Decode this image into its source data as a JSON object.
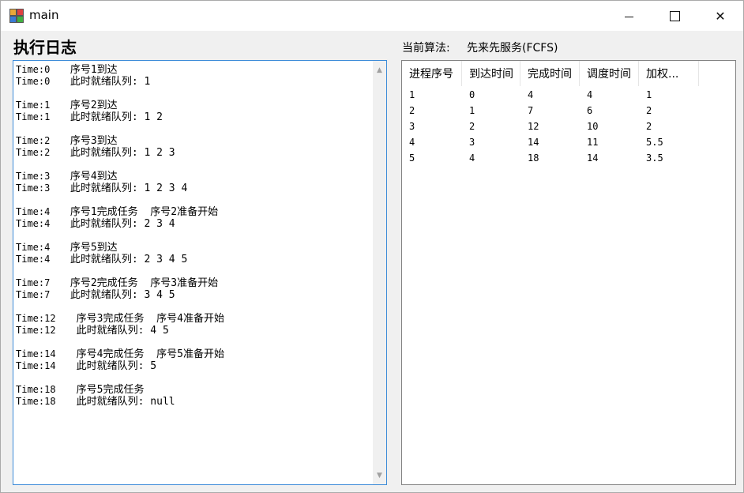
{
  "window": {
    "title": "main",
    "close_glyph": "✕"
  },
  "heading": "执行日志",
  "algorithm": {
    "label": "当前算法:",
    "value": "先来先服务(FCFS)"
  },
  "log": [
    {
      "lines": [
        {
          "time": "Time:0",
          "text": " 序号1到达"
        },
        {
          "time": "Time:0",
          "text": " 此时就绪队列: 1"
        }
      ]
    },
    {
      "lines": [
        {
          "time": "Time:1",
          "text": " 序号2到达"
        },
        {
          "time": "Time:1",
          "text": " 此时就绪队列: 1 2"
        }
      ]
    },
    {
      "lines": [
        {
          "time": "Time:2",
          "text": " 序号3到达"
        },
        {
          "time": "Time:2",
          "text": " 此时就绪队列: 1 2 3"
        }
      ]
    },
    {
      "lines": [
        {
          "time": "Time:3",
          "text": " 序号4到达"
        },
        {
          "time": "Time:3",
          "text": " 此时就绪队列: 1 2 3 4"
        }
      ]
    },
    {
      "lines": [
        {
          "time": "Time:4",
          "text": " 序号1完成任务  序号2准备开始"
        },
        {
          "time": "Time:4",
          "text": " 此时就绪队列: 2 3 4"
        }
      ]
    },
    {
      "lines": [
        {
          "time": "Time:4",
          "text": " 序号5到达"
        },
        {
          "time": "Time:4",
          "text": " 此时就绪队列: 2 3 4 5"
        }
      ]
    },
    {
      "lines": [
        {
          "time": "Time:7",
          "text": " 序号2完成任务  序号3准备开始"
        },
        {
          "time": "Time:7",
          "text": " 此时就绪队列: 3 4 5"
        }
      ]
    },
    {
      "lines": [
        {
          "time": "Time:12",
          "text": "  序号3完成任务  序号4准备开始"
        },
        {
          "time": "Time:12",
          "text": "  此时就绪队列: 4 5"
        }
      ]
    },
    {
      "lines": [
        {
          "time": "Time:14",
          "text": "  序号4完成任务  序号5准备开始"
        },
        {
          "time": "Time:14",
          "text": "  此时就绪队列: 5"
        }
      ]
    },
    {
      "lines": [
        {
          "time": "Time:18",
          "text": "  序号5完成任务"
        },
        {
          "time": "Time:18",
          "text": "  此时就绪队列: null"
        }
      ]
    }
  ],
  "table": {
    "headers": [
      "进程序号",
      "到达时间",
      "完成时间",
      "调度时间",
      "加权..."
    ],
    "rows": [
      [
        "1",
        "0",
        "4",
        "4",
        "1"
      ],
      [
        "2",
        "1",
        "7",
        "6",
        "2"
      ],
      [
        "3",
        "2",
        "12",
        "10",
        "2"
      ],
      [
        "4",
        "3",
        "14",
        "11",
        "5.5"
      ],
      [
        "5",
        "4",
        "18",
        "14",
        "3.5"
      ]
    ]
  },
  "icons": {
    "app": "app-icon",
    "minimize": "minimize-icon",
    "maximize": "maximize-icon",
    "close": "close-icon",
    "scroll_up": "scroll-up-arrow-icon",
    "scroll_down": "scroll-down-arrow-icon"
  },
  "colors": {
    "focus_border": "#3c8bd8",
    "window_bg": "#f0f0f0"
  }
}
